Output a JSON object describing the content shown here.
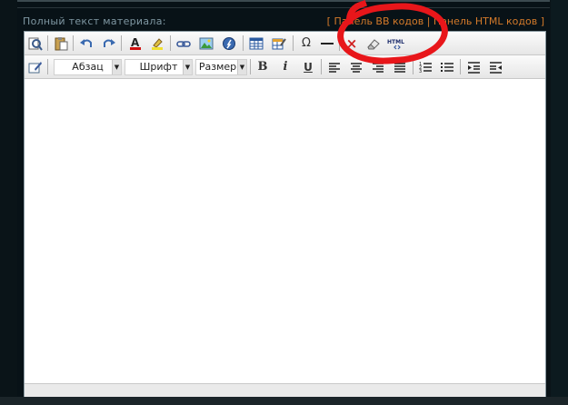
{
  "labels": {
    "field_label": "Полный текст материала:",
    "bb_panel": "Панель BB кодов",
    "html_panel": "Панель HTML кодов",
    "bracket_open": "[",
    "bracket_sep": "|",
    "bracket_close": "]"
  },
  "toolbar2": {
    "paragraph": "Абзац",
    "font": "Шрифт",
    "size": "Размер",
    "bold": "B",
    "italic": "i",
    "underline": "U"
  },
  "icons": {
    "html_glyph": "HTML",
    "omega": "Ω",
    "remove": "×"
  },
  "colors": {
    "accent": "#d47a2a",
    "annotation": "#e8161a",
    "background": "#081217"
  }
}
